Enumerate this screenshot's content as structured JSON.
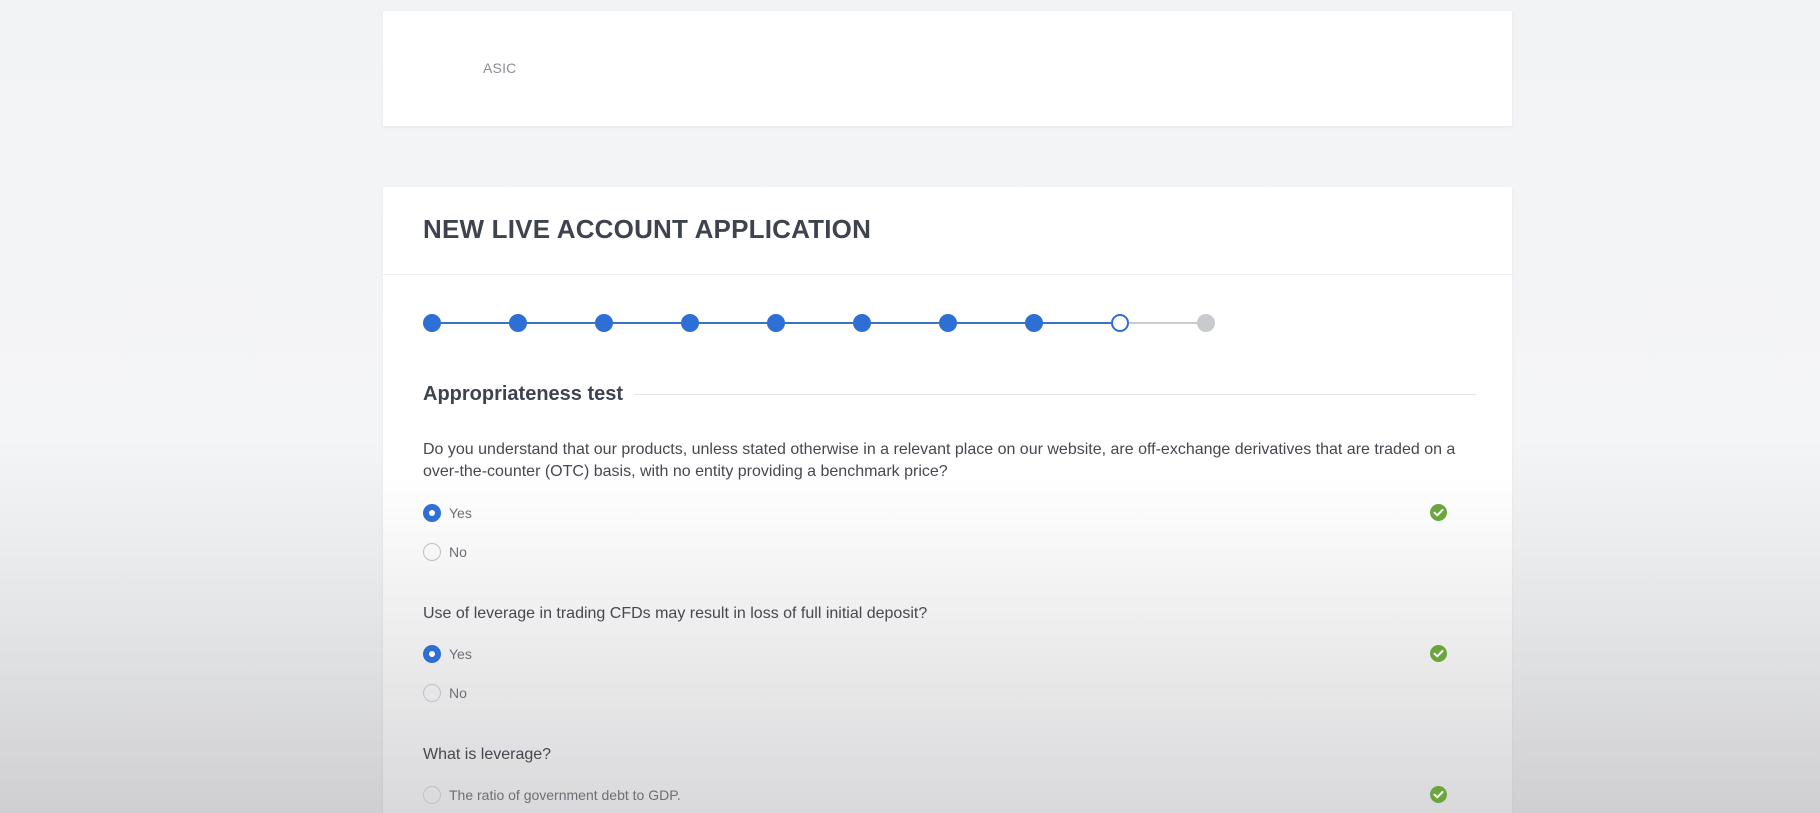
{
  "regulator_card": {
    "label": "ASIC"
  },
  "form": {
    "title": "NEW LIVE ACCOUNT APPLICATION",
    "steps": {
      "total": 10,
      "completed": 8,
      "current": 9
    },
    "section_title": "Appropriateness test",
    "questions": [
      {
        "text": "Do you understand that our products, unless stated otherwise in a relevant place on our website, are off-exchange derivatives that are traded on a over-the-counter (OTC) basis, with no entity providing a benchmark price?",
        "options": [
          {
            "label": "Yes",
            "selected": true
          },
          {
            "label": "No",
            "selected": false
          }
        ],
        "validated": true
      },
      {
        "text": "Use of leverage in trading CFDs may result in loss of full initial deposit?",
        "options": [
          {
            "label": "Yes",
            "selected": true
          },
          {
            "label": "No",
            "selected": false
          }
        ],
        "validated": true
      },
      {
        "text": "What is leverage?",
        "options": [
          {
            "label": "The ratio of government debt to GDP.",
            "selected": false
          }
        ],
        "validated": true
      }
    ]
  },
  "colors": {
    "accent": "#2e6fd6",
    "valid": "#6aa63d",
    "title": "#3f4350"
  }
}
